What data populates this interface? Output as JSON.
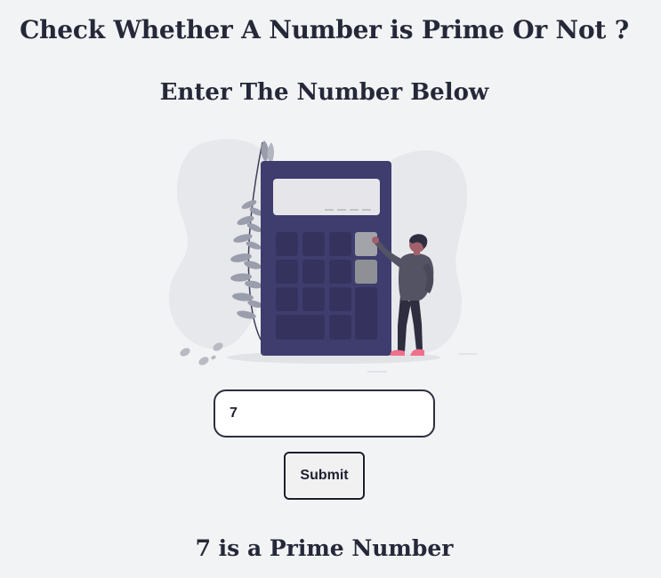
{
  "page": {
    "title": "Check Whether A Number is Prime Or Not ?",
    "subtitle": "Enter The Number Below"
  },
  "illustration": {
    "icon": "calculator-person-illustration",
    "colors": {
      "calculator": "#3f3d6e",
      "screen": "#e6e6ea",
      "accent_key": "#a3a4aa",
      "shirt": "#545363",
      "shoes": "#f06f8a",
      "leaves": "#9a9dab"
    }
  },
  "form": {
    "number_value": "7",
    "submit_label": "Submit"
  },
  "result": {
    "text": "7 is a Prime Number"
  },
  "colors": {
    "background": "#f2f3f5",
    "text": "#252838",
    "input_border": "#2c2f3e"
  }
}
